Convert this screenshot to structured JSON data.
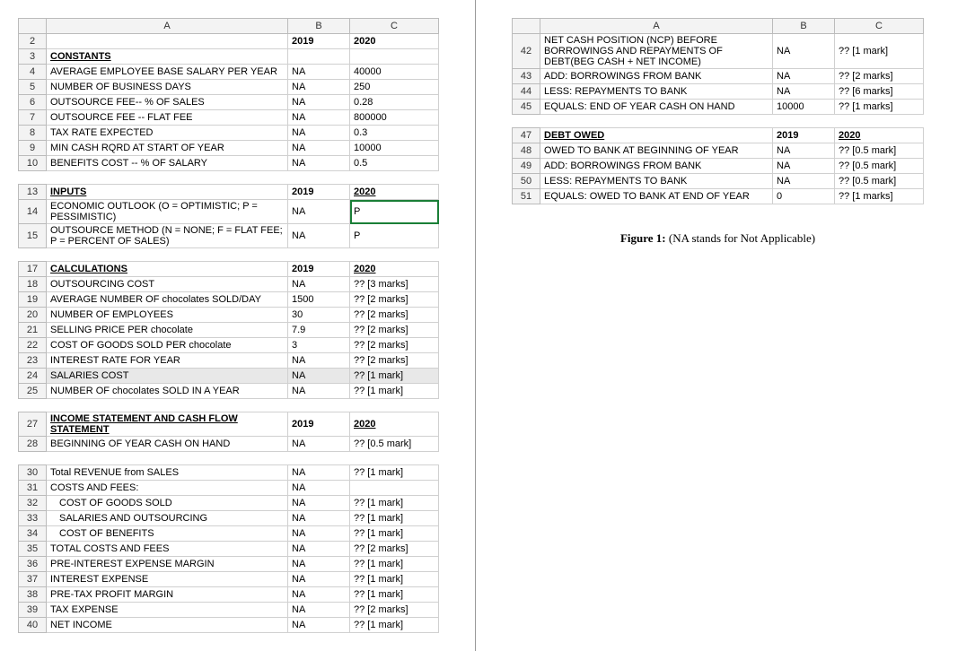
{
  "left": {
    "headers": [
      "A",
      "B",
      "C"
    ],
    "rows": [
      {
        "num": "2",
        "a": "",
        "b": "2019",
        "c": "2020",
        "b_bold": true,
        "c_bold": true
      },
      {
        "num": "3",
        "a": "CONSTANTS",
        "a_bold": true,
        "a_underline": true
      },
      {
        "num": "4",
        "a": "AVERAGE EMPLOYEE BASE SALARY PER YEAR",
        "b": "NA",
        "c": "40000"
      },
      {
        "num": "5",
        "a": "NUMBER OF BUSINESS DAYS",
        "b": "NA",
        "c": "250"
      },
      {
        "num": "6",
        "a": "OUTSOURCE FEE-- % OF SALES",
        "b": "NA",
        "c": "0.28"
      },
      {
        "num": "7",
        "a": "OUTSOURCE FEE -- FLAT FEE",
        "b": "NA",
        "c": "800000"
      },
      {
        "num": "8",
        "a": "TAX RATE EXPECTED",
        "b": "NA",
        "c": "0.3"
      },
      {
        "num": "9",
        "a": "MIN CASH RQRD AT START OF YEAR",
        "b": "NA",
        "c": "10000"
      },
      {
        "num": "10",
        "a": "BENEFITS COST -- % OF SALARY",
        "b": "NA",
        "c": "0.5"
      },
      {
        "gap": true
      },
      {
        "num": "13",
        "a": "INPUTS",
        "a_bold": true,
        "a_underline": true,
        "b": "2019",
        "c": "2020",
        "b_bold": true,
        "c_bold": true,
        "c_underline": true
      },
      {
        "num": "14",
        "a": "ECONOMIC OUTLOOK (O = OPTIMISTIC; P = PESSIMISTIC)",
        "a_wrap": true,
        "b": "NA",
        "c": "P",
        "selected": "c"
      },
      {
        "num": "15",
        "a": "OUTSOURCE METHOD (N = NONE; F = FLAT FEE; P = PERCENT OF SALES)",
        "a_wrap": true,
        "b": "NA",
        "c": "P"
      },
      {
        "gap": true
      },
      {
        "num": "17",
        "a": "CALCULATIONS",
        "a_bold": true,
        "a_underline": true,
        "b": "2019",
        "c": "2020",
        "b_bold": true,
        "c_bold": true,
        "c_underline": true
      },
      {
        "num": "18",
        "a": "OUTSOURCING COST",
        "b": "NA",
        "c": "?? [3 marks]"
      },
      {
        "num": "19",
        "a": "AVERAGE NUMBER OF chocolates SOLD/DAY",
        "b": "1500",
        "c": "?? [2 marks]"
      },
      {
        "num": "20",
        "a": "NUMBER OF EMPLOYEES",
        "b": "30",
        "c": "?? [2 marks]"
      },
      {
        "num": "21",
        "a": "SELLING PRICE PER chocolate",
        "b": "7.9",
        "c": "?? [2 marks]"
      },
      {
        "num": "22",
        "a": "COST OF GOODS SOLD PER chocolate",
        "b": "3",
        "c": "?? [2 marks]"
      },
      {
        "num": "23",
        "a": "INTEREST RATE FOR YEAR",
        "b": "NA",
        "c": "?? [2 marks]"
      },
      {
        "num": "24",
        "a": "SALARIES COST",
        "b": "NA",
        "c": "?? [1 mark]",
        "highlight": true
      },
      {
        "num": "25",
        "a": "NUMBER OF chocolates SOLD IN A YEAR",
        "b": "NA",
        "c": "?? [1 mark]"
      },
      {
        "gap": true
      },
      {
        "num": "27",
        "a": "INCOME STATEMENT AND CASH FLOW STATEMENT",
        "a_wrap": true,
        "a_bold": true,
        "a_underline": true,
        "b": "2019",
        "c": "2020",
        "b_bold": true,
        "c_bold": true,
        "c_underline": true
      },
      {
        "num": "28",
        "a": "BEGINNING OF YEAR CASH ON HAND",
        "b": "NA",
        "c": "?? [0.5 mark]"
      },
      {
        "gap": true
      },
      {
        "num": "30",
        "a": "Total REVENUE from SALES",
        "b": "NA",
        "c": "?? [1 mark]"
      },
      {
        "num": "31",
        "a": "COSTS AND FEES:",
        "b": "NA"
      },
      {
        "num": "32",
        "a": "COST OF GOODS SOLD",
        "a_indent": true,
        "b": "NA",
        "c": "?? [1 mark]"
      },
      {
        "num": "33",
        "a": "SALARIES AND OUTSOURCING",
        "a_indent": true,
        "b": "NA",
        "c": "?? [1 mark]"
      },
      {
        "num": "34",
        "a": "COST OF BENEFITS",
        "a_indent": true,
        "b": "NA",
        "c": "?? [1 mark]"
      },
      {
        "num": "35",
        "a": "TOTAL COSTS AND FEES",
        "b": "NA",
        "c": "?? [2 marks]"
      },
      {
        "num": "36",
        "a": "PRE-INTEREST EXPENSE MARGIN",
        "b": "NA",
        "c": "?? [1 mark]"
      },
      {
        "num": "37",
        "a": "INTEREST EXPENSE",
        "b": "NA",
        "c": "?? [1 mark]"
      },
      {
        "num": "38",
        "a": "PRE-TAX PROFIT MARGIN",
        "b": "NA",
        "c": "?? [1 mark]"
      },
      {
        "num": "39",
        "a": "TAX EXPENSE",
        "b": "NA",
        "c": "?? [2 marks]"
      },
      {
        "num": "40",
        "a": "NET INCOME",
        "b": "NA",
        "c": "?? [1 mark]"
      }
    ]
  },
  "right": {
    "headers": [
      "A",
      "B",
      "C"
    ],
    "rows": [
      {
        "num": "42",
        "a": "NET CASH POSITION (NCP) BEFORE BORROWINGS AND REPAYMENTS OF DEBT(BEG CASH + NET INCOME)",
        "a_wrap": true,
        "b": "NA",
        "c": "?? [1 mark]"
      },
      {
        "num": "43",
        "a": "ADD: BORROWINGS FROM BANK",
        "b": "NA",
        "c": "?? [2 marks]"
      },
      {
        "num": "44",
        "a": "LESS: REPAYMENTS TO BANK",
        "b": "NA",
        "c": "?? [6 marks]"
      },
      {
        "num": "45",
        "a": "EQUALS: END OF YEAR CASH ON HAND",
        "b": "10000",
        "c": "?? [1 marks]"
      },
      {
        "gap": true
      },
      {
        "num": "47",
        "a": "DEBT OWED",
        "a_bold": true,
        "a_underline": true,
        "b": "2019",
        "c": "2020",
        "b_bold": true,
        "c_bold": true,
        "c_underline": true
      },
      {
        "num": "48",
        "a": "OWED TO BANK AT BEGINNING OF YEAR",
        "b": "NA",
        "c": "?? [0.5 mark]"
      },
      {
        "num": "49",
        "a": "ADD: BORROWINGS FROM BANK",
        "b": "NA",
        "c": "?? [0.5 mark]"
      },
      {
        "num": "50",
        "a": "LESS: REPAYMENTS TO BANK",
        "b": "NA",
        "c": "?? [0.5 mark]"
      },
      {
        "num": "51",
        "a": "EQUALS: OWED TO BANK AT END OF YEAR",
        "b": "0",
        "c": "?? [1 marks]"
      }
    ],
    "caption_prefix": "Figure 1: ",
    "caption_rest": "(NA stands for Not Applicable)"
  }
}
